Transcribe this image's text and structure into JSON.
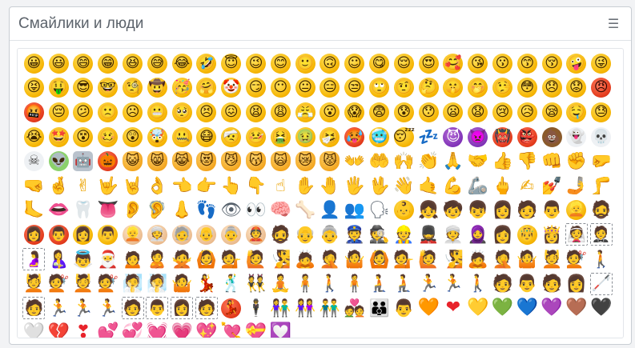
{
  "panel": {
    "title": "Смайлики и люди",
    "menu_icon_glyph": "☰"
  },
  "colors": {
    "face_yellow": "#f5b300",
    "header_text": "#5c636b",
    "border": "#c9ced4"
  },
  "emojis": [
    {
      "g": "😀",
      "k": "face"
    },
    {
      "g": "😃",
      "k": "face"
    },
    {
      "g": "😄",
      "k": "face"
    },
    {
      "g": "😁",
      "k": "face"
    },
    {
      "g": "😆",
      "k": "face"
    },
    {
      "g": "😅",
      "k": "face"
    },
    {
      "g": "😂",
      "k": "face"
    },
    {
      "g": "🤣",
      "k": "face"
    },
    {
      "g": "😇",
      "k": "face"
    },
    {
      "g": "😉",
      "k": "face"
    },
    {
      "g": "😊",
      "k": "face"
    },
    {
      "g": "🙂",
      "k": "face"
    },
    {
      "g": "🙃",
      "k": "face"
    },
    {
      "g": "☺",
      "k": "face"
    },
    {
      "g": "😋",
      "k": "face"
    },
    {
      "g": "😌",
      "k": "face"
    },
    {
      "g": "😍",
      "k": "face"
    },
    {
      "g": "🥰",
      "k": "face"
    },
    {
      "g": "😘",
      "k": "face"
    },
    {
      "g": "😗",
      "k": "face"
    },
    {
      "g": "😙",
      "k": "face"
    },
    {
      "g": "😚",
      "k": "face"
    },
    {
      "g": "🤪",
      "k": "face"
    },
    {
      "g": "😜",
      "k": "face"
    },
    {
      "g": "😝",
      "k": "face"
    },
    {
      "g": "🤑",
      "k": "face"
    },
    {
      "g": "😎",
      "k": "face"
    },
    {
      "g": "🤓",
      "k": "face"
    },
    {
      "g": "🧐",
      "k": "face"
    },
    {
      "g": "🤠",
      "k": "face"
    },
    {
      "g": "🥳",
      "k": "face"
    },
    {
      "g": "🤗",
      "k": "face"
    },
    {
      "g": "🤡",
      "k": "face"
    },
    {
      "g": "😏",
      "k": "face"
    },
    {
      "g": "😶",
      "k": "face"
    },
    {
      "g": "😐",
      "k": "face"
    },
    {
      "g": "😑",
      "k": "face"
    },
    {
      "g": "😒",
      "k": "face"
    },
    {
      "g": "🙄",
      "k": "face"
    },
    {
      "g": "🤨",
      "k": "face"
    },
    {
      "g": "🤔",
      "k": "face"
    },
    {
      "g": "🤫",
      "k": "face"
    },
    {
      "g": "🤭",
      "k": "face"
    },
    {
      "g": "🤥",
      "k": "face"
    },
    {
      "g": "😳",
      "k": "face"
    },
    {
      "g": "😞",
      "k": "face"
    },
    {
      "g": "😟",
      "k": "face"
    },
    {
      "g": "😠",
      "k": "angry"
    },
    {
      "g": "🤬",
      "k": "angry"
    },
    {
      "g": "😔",
      "k": "face"
    },
    {
      "g": "😕",
      "k": "face"
    },
    {
      "g": "🙁",
      "k": "face"
    },
    {
      "g": "☹",
      "k": "face"
    },
    {
      "g": "😬",
      "k": "face"
    },
    {
      "g": "🥺",
      "k": "face"
    },
    {
      "g": "😣",
      "k": "face"
    },
    {
      "g": "😖",
      "k": "face"
    },
    {
      "g": "😫",
      "k": "face"
    },
    {
      "g": "😩",
      "k": "face"
    },
    {
      "g": "😤",
      "k": "face"
    },
    {
      "g": "😮",
      "k": "face"
    },
    {
      "g": "😱",
      "k": "face"
    },
    {
      "g": "😨",
      "k": "face"
    },
    {
      "g": "😰",
      "k": "face"
    },
    {
      "g": "😯",
      "k": "face"
    },
    {
      "g": "😦",
      "k": "face"
    },
    {
      "g": "😧",
      "k": "face"
    },
    {
      "g": "😢",
      "k": "face"
    },
    {
      "g": "😥",
      "k": "face"
    },
    {
      "g": "😪",
      "k": "face"
    },
    {
      "g": "🤤",
      "k": "face"
    },
    {
      "g": "😓",
      "k": "face"
    },
    {
      "g": "😭",
      "k": "face"
    },
    {
      "g": "🤩",
      "k": "face"
    },
    {
      "g": "😵",
      "k": "face"
    },
    {
      "g": "🥴",
      "k": "face"
    },
    {
      "g": "😲",
      "k": "face"
    },
    {
      "g": "🤯",
      "k": "face"
    },
    {
      "g": "🤐",
      "k": "face"
    },
    {
      "g": "😷",
      "k": "face"
    },
    {
      "g": "🤕",
      "k": "face"
    },
    {
      "g": "🤒",
      "k": "face"
    },
    {
      "g": "🤮",
      "k": "face"
    },
    {
      "g": "🤢",
      "k": "face"
    },
    {
      "g": "🤧",
      "k": "face"
    },
    {
      "g": "🥵",
      "k": "angry"
    },
    {
      "g": "🥶",
      "k": "face"
    },
    {
      "g": "😴",
      "k": "face"
    },
    {
      "g": "💤",
      "k": "other"
    },
    {
      "g": "😈",
      "k": "monster"
    },
    {
      "g": "👿",
      "k": "monster"
    },
    {
      "g": "👹",
      "k": "angry"
    },
    {
      "g": "👺",
      "k": "angry"
    },
    {
      "g": "💩",
      "k": "poo"
    },
    {
      "g": "👻",
      "k": "ghost"
    },
    {
      "g": "💀",
      "k": "ghost"
    },
    {
      "g": "☠",
      "k": "ghost"
    },
    {
      "g": "👽",
      "k": "alien"
    },
    {
      "g": "🤖",
      "k": "robot"
    },
    {
      "g": "🎃",
      "k": "angry"
    },
    {
      "g": "😺",
      "k": "cat"
    },
    {
      "g": "😸",
      "k": "cat"
    },
    {
      "g": "😹",
      "k": "cat"
    },
    {
      "g": "😻",
      "k": "cat"
    },
    {
      "g": "😼",
      "k": "cat"
    },
    {
      "g": "😽",
      "k": "cat"
    },
    {
      "g": "🙀",
      "k": "cat"
    },
    {
      "g": "😿",
      "k": "cat"
    },
    {
      "g": "😾",
      "k": "cat"
    },
    {
      "g": "👐",
      "k": "hand"
    },
    {
      "g": "🤲",
      "k": "hand"
    },
    {
      "g": "🙌",
      "k": "hand"
    },
    {
      "g": "👏",
      "k": "hand"
    },
    {
      "g": "🙏",
      "k": "hand"
    },
    {
      "g": "🤝",
      "k": "hand"
    },
    {
      "g": "👍",
      "k": "hand"
    },
    {
      "g": "👎",
      "k": "hand"
    },
    {
      "g": "👊",
      "k": "hand"
    },
    {
      "g": "✊",
      "k": "hand"
    },
    {
      "g": "🤛",
      "k": "hand"
    },
    {
      "g": "🤜",
      "k": "hand"
    },
    {
      "g": "🤞",
      "k": "hand"
    },
    {
      "g": "✌",
      "k": "hand"
    },
    {
      "g": "🤟",
      "k": "hand"
    },
    {
      "g": "🤘",
      "k": "hand"
    },
    {
      "g": "👌",
      "k": "hand"
    },
    {
      "g": "👈",
      "k": "hand"
    },
    {
      "g": "👉",
      "k": "hand"
    },
    {
      "g": "👆",
      "k": "hand"
    },
    {
      "g": "👇",
      "k": "hand"
    },
    {
      "g": "☝",
      "k": "hand"
    },
    {
      "g": "✋",
      "k": "hand"
    },
    {
      "g": "🤚",
      "k": "hand"
    },
    {
      "g": "🖐",
      "k": "hand"
    },
    {
      "g": "🖖",
      "k": "hand"
    },
    {
      "g": "👋",
      "k": "hand"
    },
    {
      "g": "🤙",
      "k": "hand"
    },
    {
      "g": "💪",
      "k": "hand"
    },
    {
      "g": "🦾",
      "k": "other"
    },
    {
      "g": "🖕",
      "k": "hand"
    },
    {
      "g": "✍",
      "k": "hand"
    },
    {
      "g": "💅",
      "k": "hand"
    },
    {
      "g": "🤳",
      "k": "hand"
    },
    {
      "g": "🦵",
      "k": "hand"
    },
    {
      "g": "🦶",
      "k": "hand"
    },
    {
      "g": "👄",
      "k": "heart"
    },
    {
      "g": "🦷",
      "k": "other"
    },
    {
      "g": "👅",
      "k": "heart"
    },
    {
      "g": "👂",
      "k": "hand"
    },
    {
      "g": "🦻",
      "k": "hand"
    },
    {
      "g": "👃",
      "k": "hand"
    },
    {
      "g": "👣",
      "k": "other"
    },
    {
      "g": "👁",
      "k": "other"
    },
    {
      "g": "👀",
      "k": "other"
    },
    {
      "g": "🧠",
      "k": "heart"
    },
    {
      "g": "🦴",
      "k": "other"
    },
    {
      "g": "👤",
      "k": "other"
    },
    {
      "g": "👥",
      "k": "other"
    },
    {
      "g": "🗣",
      "k": "other"
    },
    {
      "g": "👶",
      "k": "face"
    },
    {
      "g": "👧",
      "k": "person"
    },
    {
      "g": "🧒",
      "k": "person"
    },
    {
      "g": "👦",
      "k": "person"
    },
    {
      "g": "👩",
      "k": "person"
    },
    {
      "g": "🧑",
      "k": "person"
    },
    {
      "g": "👨",
      "k": "person"
    },
    {
      "g": "👱",
      "k": "face"
    },
    {
      "g": "🧔",
      "k": "person"
    },
    {
      "g": "👩",
      "k": "angry"
    },
    {
      "g": "👨",
      "k": "angry"
    },
    {
      "g": "👩",
      "k": "face"
    },
    {
      "g": "👨",
      "k": "face"
    },
    {
      "g": "👱",
      "k": "skin"
    },
    {
      "g": "👳",
      "k": "skin"
    },
    {
      "g": "🧓",
      "k": "skin"
    },
    {
      "g": "👴",
      "k": "skin"
    },
    {
      "g": "👵",
      "k": "skin"
    },
    {
      "g": "👲",
      "k": "skin"
    },
    {
      "g": "🧔",
      "k": "person"
    },
    {
      "g": "👴",
      "k": "person"
    },
    {
      "g": "👵",
      "k": "person"
    },
    {
      "g": "👮",
      "k": "person"
    },
    {
      "g": "🕵",
      "k": "person"
    },
    {
      "g": "👷",
      "k": "person"
    },
    {
      "g": "💂",
      "k": "person"
    },
    {
      "g": "👳",
      "k": "person"
    },
    {
      "g": "🧕",
      "k": "person"
    },
    {
      "g": "👩",
      "k": "person"
    },
    {
      "g": "🤴",
      "k": "face"
    },
    {
      "g": "👸",
      "k": "person"
    },
    {
      "g": "👰",
      "k": "person-dashed"
    },
    {
      "g": "🤵",
      "k": "person-dashed"
    },
    {
      "g": "🤰",
      "k": "person-dashed"
    },
    {
      "g": "🤱",
      "k": "person"
    },
    {
      "g": "👼",
      "k": "person"
    },
    {
      "g": "🎅",
      "k": "person"
    },
    {
      "g": "🙍",
      "k": "person"
    },
    {
      "g": "🙎",
      "k": "person"
    },
    {
      "g": "🙅",
      "k": "person"
    },
    {
      "g": "🙆",
      "k": "person"
    },
    {
      "g": "💁",
      "k": "person"
    },
    {
      "g": "🙋",
      "k": "person"
    },
    {
      "g": "🧏",
      "k": "person"
    },
    {
      "g": "🙇",
      "k": "person"
    },
    {
      "g": "🤦",
      "k": "person"
    },
    {
      "g": "🤷",
      "k": "person"
    },
    {
      "g": "🙆",
      "k": "person"
    },
    {
      "g": "💁",
      "k": "person"
    },
    {
      "g": "🙋",
      "k": "person"
    },
    {
      "g": "🧏",
      "k": "person"
    },
    {
      "g": "🙇",
      "k": "person"
    },
    {
      "g": "🤦",
      "k": "person"
    },
    {
      "g": "🤷",
      "k": "person"
    },
    {
      "g": "💆",
      "k": "person"
    },
    {
      "g": "💇",
      "k": "person"
    },
    {
      "g": "🚶",
      "k": "person"
    },
    {
      "g": "💆",
      "k": "person"
    },
    {
      "g": "💇",
      "k": "person"
    },
    {
      "g": "💆",
      "k": "person"
    },
    {
      "g": "💇",
      "k": "person"
    },
    {
      "g": "🧖",
      "k": "person"
    },
    {
      "g": "🧖",
      "k": "person"
    },
    {
      "g": "🤷",
      "k": "person"
    },
    {
      "g": "💃",
      "k": "person"
    },
    {
      "g": "🕺",
      "k": "person"
    },
    {
      "g": "👯",
      "k": "person"
    },
    {
      "g": "🧘",
      "k": "person"
    },
    {
      "g": "🧍",
      "k": "person"
    },
    {
      "g": "🚶",
      "k": "person"
    },
    {
      "g": "🧍",
      "k": "person"
    },
    {
      "g": "🧎",
      "k": "person"
    },
    {
      "g": "🧎",
      "k": "person"
    },
    {
      "g": "🏃",
      "k": "person"
    },
    {
      "g": "🏃",
      "k": "person"
    },
    {
      "g": "🚶",
      "k": "person"
    },
    {
      "g": "🧑",
      "k": "person"
    },
    {
      "g": "👨",
      "k": "person"
    },
    {
      "g": "🧑",
      "k": "person"
    },
    {
      "g": "👩",
      "k": "person"
    },
    {
      "g": "🦯",
      "k": "person-dashed"
    },
    {
      "g": "🧑",
      "k": "person-dashed"
    },
    {
      "g": "🏃",
      "k": "person"
    },
    {
      "g": "🏃",
      "k": "person"
    },
    {
      "g": "🏃",
      "k": "person"
    },
    {
      "g": "🧑",
      "k": "person-dashed"
    },
    {
      "g": "👨",
      "k": "person-dashed"
    },
    {
      "g": "👩",
      "k": "person-dashed"
    },
    {
      "g": "🧑",
      "k": "person-dashed"
    },
    {
      "g": "💃",
      "k": "angry"
    },
    {
      "g": "🕴",
      "k": "person"
    },
    {
      "g": "👫",
      "k": "person"
    },
    {
      "g": "👭",
      "k": "person"
    },
    {
      "g": "👬",
      "k": "person"
    },
    {
      "g": "💑",
      "k": "person"
    },
    {
      "g": "👪",
      "k": "person"
    },
    {
      "g": "👨",
      "k": "person"
    },
    {
      "g": "🧡",
      "k": "heart",
      "c": "#f37b15"
    },
    {
      "g": "❤",
      "k": "heart",
      "c": "#e8232b"
    },
    {
      "g": "💛",
      "k": "heart",
      "c": "#f8c600"
    },
    {
      "g": "💚",
      "k": "heart",
      "c": "#22b33a"
    },
    {
      "g": "💙",
      "k": "heart",
      "c": "#1f7fe0"
    },
    {
      "g": "💜",
      "k": "heart",
      "c": "#8a4fd9"
    },
    {
      "g": "🤎",
      "k": "heart",
      "c": "#7a4a1f"
    },
    {
      "g": "🖤",
      "k": "heart",
      "c": "#2c2c2c"
    },
    {
      "g": "🤍",
      "k": "heart",
      "c": "#e6e6e6"
    },
    {
      "g": "💔",
      "k": "heart",
      "c": "#d81f2a"
    },
    {
      "g": "❣",
      "k": "heart",
      "c": "#e8232b"
    },
    {
      "g": "💕",
      "k": "heart",
      "c": "#ef4a68"
    },
    {
      "g": "💞",
      "k": "heart",
      "c": "#d81f2a"
    },
    {
      "g": "💓",
      "k": "heart",
      "c": "#e8232b"
    },
    {
      "g": "💗",
      "k": "heart",
      "c": "#f05a7a"
    },
    {
      "g": "💖",
      "k": "heart",
      "c": "#e8232b"
    },
    {
      "g": "💘",
      "k": "heart",
      "c": "#e8232b"
    },
    {
      "g": "💝",
      "k": "heart",
      "c": "#e8232b"
    },
    {
      "g": "💟",
      "k": "heart",
      "c": "#e0517a"
    }
  ]
}
